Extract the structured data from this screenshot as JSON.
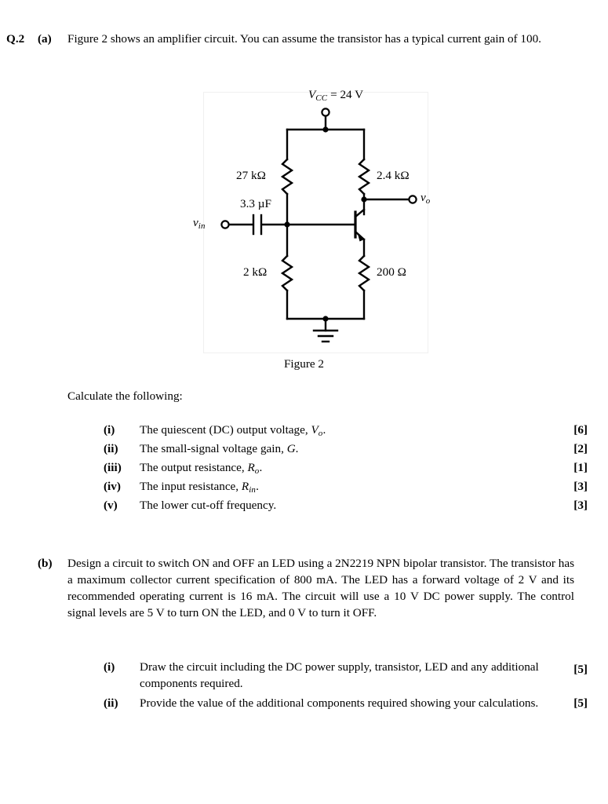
{
  "question": {
    "number": "Q.2",
    "parts": [
      {
        "label": "(a)",
        "text": "Figure 2 shows an amplifier circuit. You can assume the transistor has a typical current gain of 100.",
        "lead_in": "Calculate the following:",
        "items": [
          {
            "num": "(i)",
            "text_before": "The quiescent (DC) output voltage, ",
            "symbol": "V",
            "symbol_sub": "o",
            "text_after": ".",
            "marks": "[6]"
          },
          {
            "num": "(ii)",
            "text_before": "The small-signal voltage gain, ",
            "symbol": "G",
            "symbol_sub": "",
            "text_after": ".",
            "marks": "[2]"
          },
          {
            "num": "(iii)",
            "text_before": "The output resistance, ",
            "symbol": "R",
            "symbol_sub": "o",
            "text_after": ".",
            "marks": "[1]"
          },
          {
            "num": "(iv)",
            "text_before": "The input resistance, ",
            "symbol": "R",
            "symbol_sub": "in",
            "text_after": ".",
            "marks": "[3]"
          },
          {
            "num": "(v)",
            "text_before": "The lower cut-off frequency.",
            "symbol": "",
            "symbol_sub": "",
            "text_after": "",
            "marks": "[3]"
          }
        ]
      },
      {
        "label": "(b)",
        "text": "Design a circuit to switch ON and OFF an LED using a 2N2219 NPN bipolar transistor. The transistor has a maximum collector current specification of 800 mA. The LED has a forward voltage of  2 V and its recommended operating current is 16 mA. The circuit will use a 10 V DC power supply. The control signal levels are 5 V to turn ON the LED, and 0 V to turn it OFF.",
        "items": [
          {
            "num": "(i)",
            "text": "Draw the circuit including the DC power supply, transistor, LED and any additional components required.",
            "marks": "[5]"
          },
          {
            "num": "(ii)",
            "text": "Provide the value of the additional components required showing your calculations.",
            "marks": "[5]"
          }
        ]
      }
    ]
  },
  "figure": {
    "caption": "Figure 2",
    "supply_symbol": "V",
    "supply_subscript": "CC",
    "supply_equals": "=",
    "supply_value": "24 V",
    "input_symbol": "v",
    "input_subscript": "in",
    "output_symbol": "v",
    "output_subscript": "o",
    "components": {
      "r1": "27 kΩ",
      "rc": "2.4 kΩ",
      "coupling_cap": "3.3 µF",
      "r2": "2 kΩ",
      "re": "200 Ω"
    },
    "colors": {
      "wire": "#000000",
      "border": "#f0f0f0"
    }
  }
}
